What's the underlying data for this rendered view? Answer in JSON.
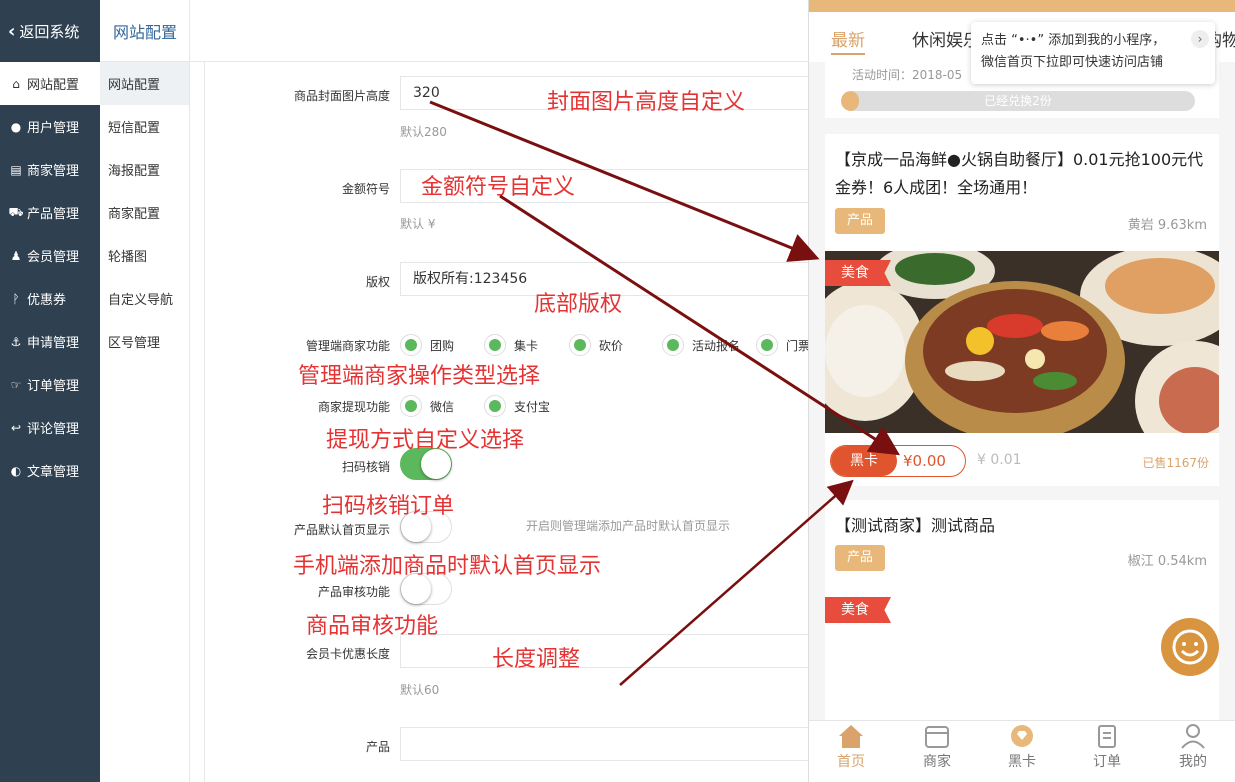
{
  "sidebar": {
    "back_label": "返回系统",
    "items": [
      {
        "label": "网站配置",
        "icon": "home-icon"
      },
      {
        "label": "用户管理",
        "icon": "user-icon"
      },
      {
        "label": "商家管理",
        "icon": "server-icon"
      },
      {
        "label": "产品管理",
        "icon": "cart-icon"
      },
      {
        "label": "会员管理",
        "icon": "member-icon"
      },
      {
        "label": "优惠券",
        "icon": "coupon-icon"
      },
      {
        "label": "申请管理",
        "icon": "anchor-icon"
      },
      {
        "label": "订单管理",
        "icon": "thumb-icon"
      },
      {
        "label": "评论管理",
        "icon": "reply-icon"
      },
      {
        "label": "文章管理",
        "icon": "contrast-icon"
      }
    ]
  },
  "subnav": {
    "header": "网站配置",
    "items": [
      "网站配置",
      "短信配置",
      "海报配置",
      "商家配置",
      "轮播图",
      "自定义导航",
      "区号管理"
    ]
  },
  "form": {
    "cover_height": {
      "label": "商品封面图片高度",
      "value": "320",
      "hint": "默认280"
    },
    "currency": {
      "label": "金额符号",
      "value": "",
      "hint": "默认 ¥"
    },
    "copyright": {
      "label": "版权",
      "value": "版权所有:123456"
    },
    "merchant_functions": {
      "label": "管理端商家功能",
      "options": [
        "团购",
        "集卡",
        "砍价",
        "活动报名",
        "门票"
      ]
    },
    "withdraw": {
      "label": "商家提现功能",
      "options": [
        "微信",
        "支付宝"
      ]
    },
    "scan_verify": {
      "label": "扫码核销",
      "on": true
    },
    "default_home": {
      "label": "产品默认首页显示",
      "on": false,
      "hint": "开启则管理端添加产品时默认首页显示"
    },
    "review": {
      "label": "产品审核功能",
      "on": false
    },
    "card_discount_length": {
      "label": "会员卡优惠长度",
      "value": "",
      "hint": "默认60"
    },
    "product": {
      "label": "产品",
      "value": ""
    }
  },
  "annotations": {
    "a1": "封面图片高度自定义",
    "a2": "金额符号自定义",
    "a3": "底部版权",
    "a4": "管理端商家操作类型选择",
    "a5": "提现方式自定义选择",
    "a6": "扫码核销订单",
    "a7": "手机端添加商品时默认首页显示",
    "a8": "商品审核功能",
    "a9": "长度调整"
  },
  "phone": {
    "tabs": [
      "最新",
      "休闲娱乐",
      "购物"
    ],
    "tooltip": {
      "line1": "点击 “•·•” 添加到我的小程序，",
      "line2": "微信首页下拉即可快速访问店铺"
    },
    "activity_time": "活动时间：2018-05",
    "progress": {
      "text": "已经兑换2份",
      "fraction": 0.05
    },
    "card1": {
      "title": "【京成一品海鲜●火锅自助餐厅】0.01元抢100元代金券！6人成团！全场通用！",
      "tag": "产品",
      "distance": "黄岩 9.63km",
      "ribbon": "美食",
      "black_card_label": "黑卡",
      "black_card_price": "¥0.00",
      "price": "¥ 0.01",
      "sold": "已售1167份"
    },
    "card2": {
      "title": "【测试商家】测试商品",
      "tag": "产品",
      "distance": "椒江 0.54km",
      "ribbon": "美食"
    },
    "nav": [
      "首页",
      "商家",
      "黑卡",
      "订单",
      "我的"
    ]
  },
  "colors": {
    "sidebar_bg": "#2f4050",
    "accent_gold": "#d9a36b",
    "annotation_red": "#e53333",
    "radio_green": "#5cb85c",
    "arrow_red": "#7a0f0f",
    "black_card_orange": "#e0542e"
  }
}
